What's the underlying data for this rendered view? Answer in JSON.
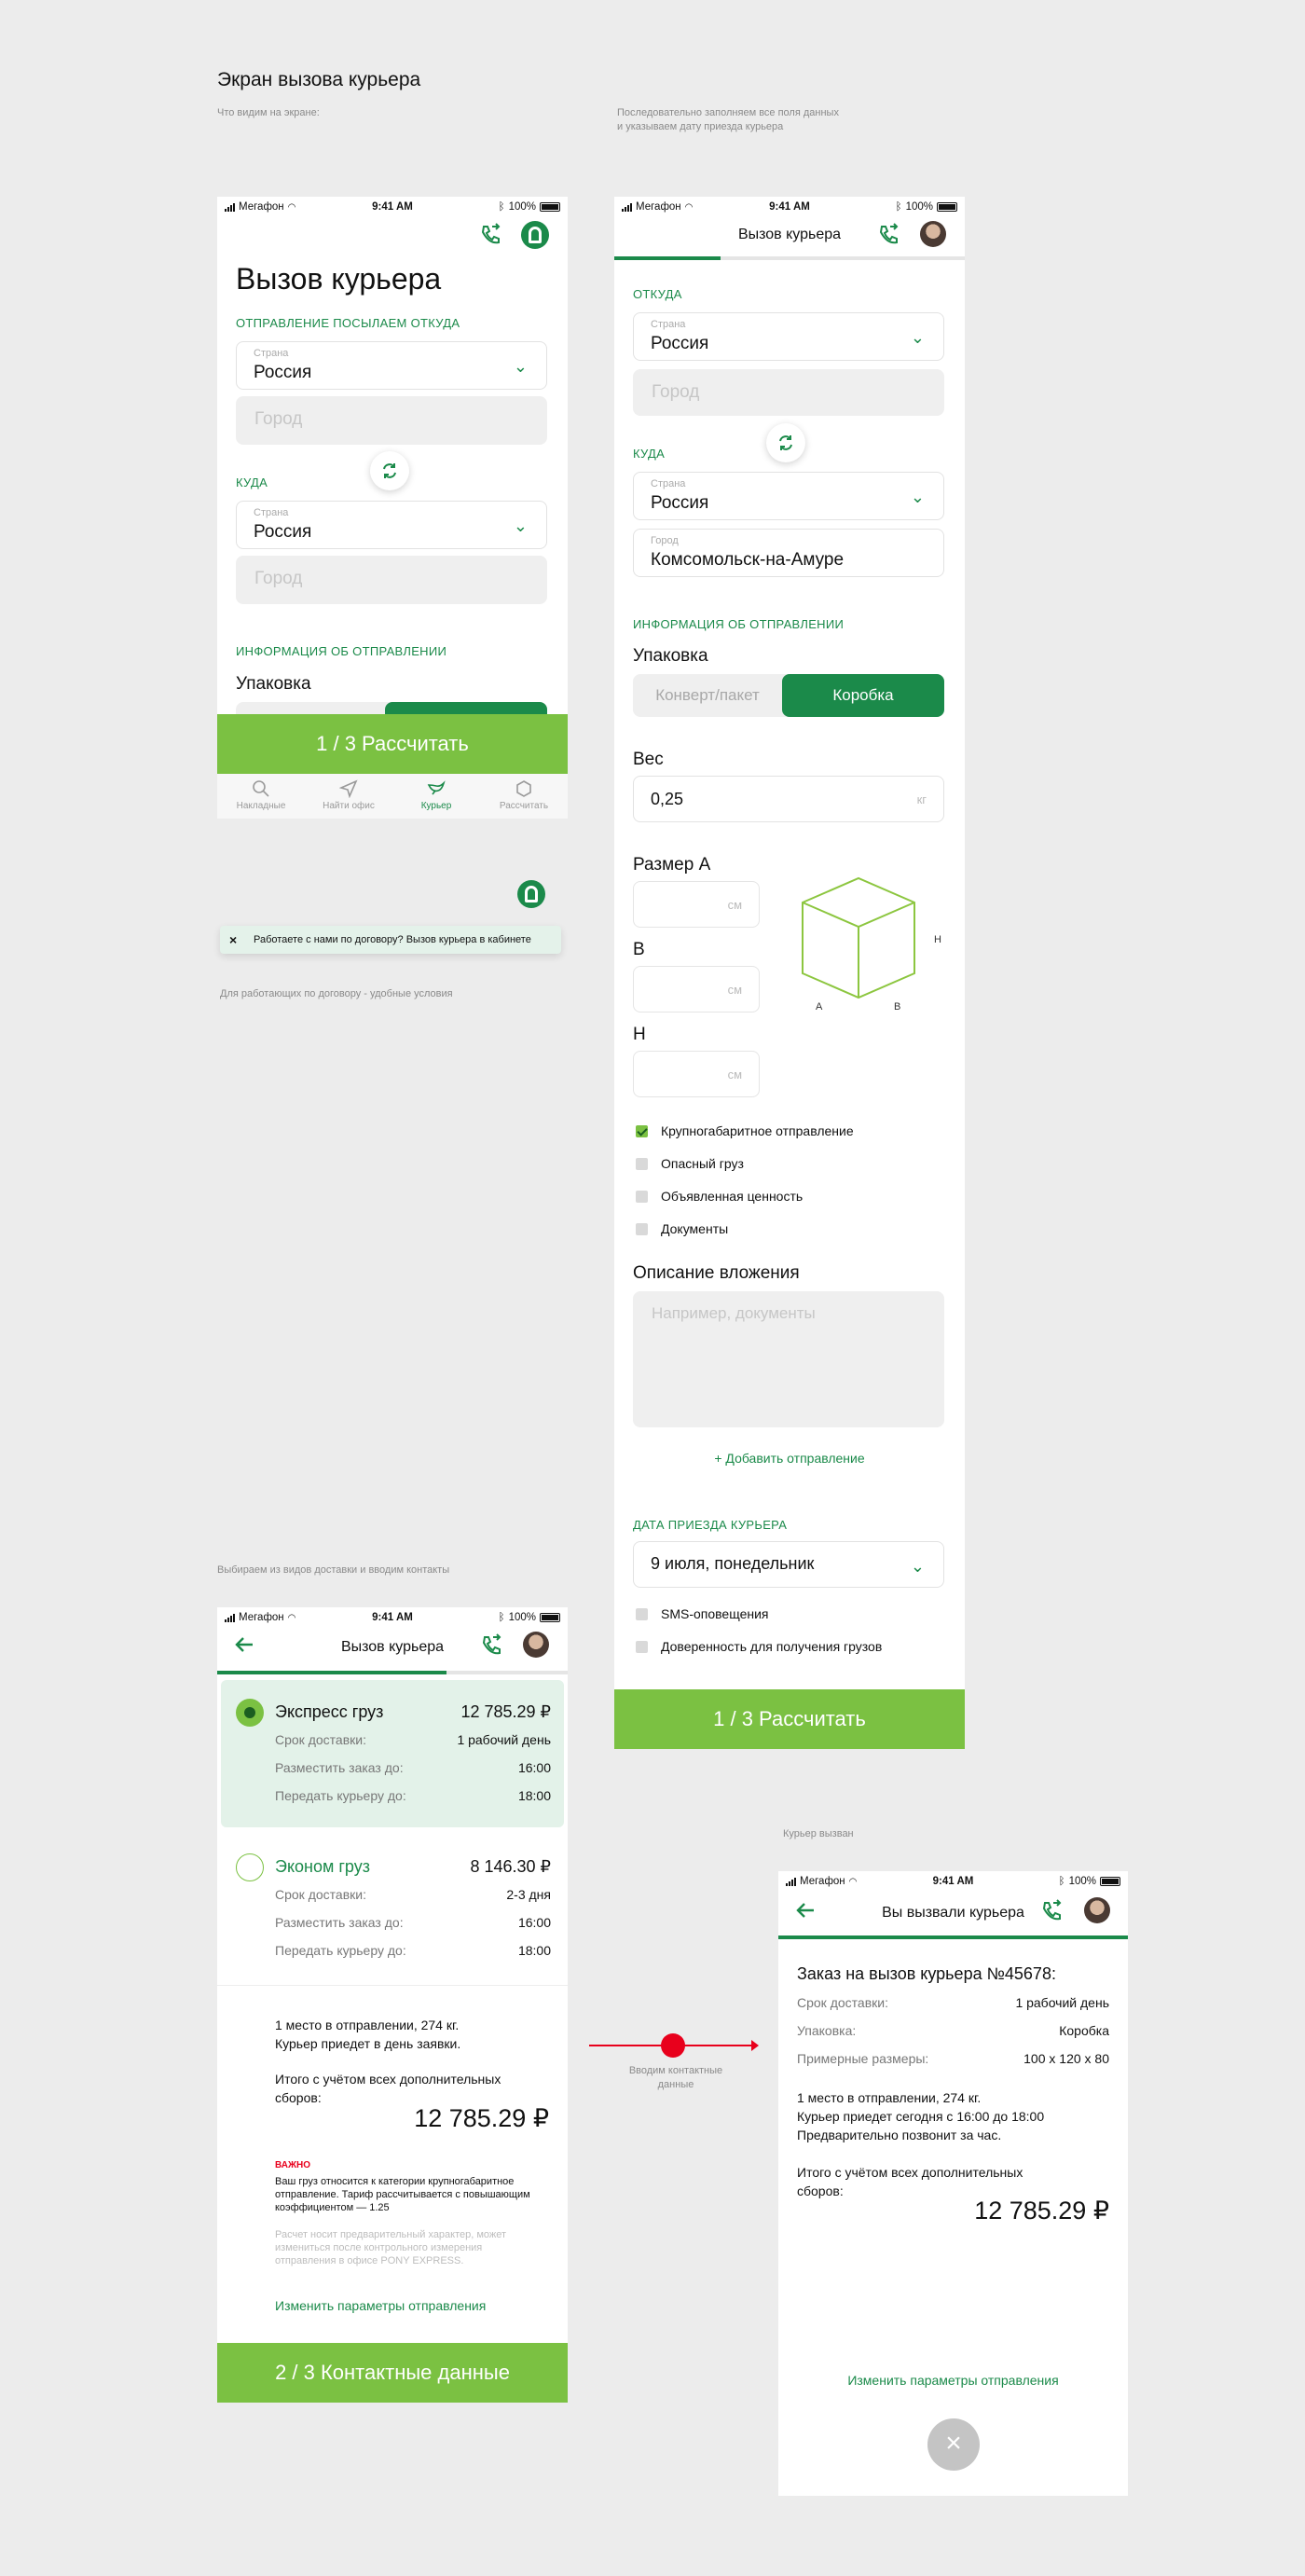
{
  "page": {
    "title": "Экран вызова курьера",
    "note1": "Что видим на экране:",
    "note2_line1": "Последовательно заполняем все поля данных",
    "note2_line2": "и указываем дату приезда курьера",
    "note3": "Для работающих по договору - удобные условия",
    "note4": "Выбираем из видов доставки и вводим контакты",
    "note5": "Курьер вызван",
    "flow_label_line1": "Вводим контактные",
    "flow_label_line2": "данные"
  },
  "status_bar": {
    "carrier": "Мегафон",
    "time": "9:41 AM",
    "battery": "100%"
  },
  "screen1": {
    "heading": "Вызов курьера",
    "from_section": "ОТПРАВЛЕНИЕ ПОСЫЛАЕМ ОТКУДА",
    "country_label": "Страна",
    "country_value": "Россия",
    "city_placeholder": "Город",
    "to_section": "КУДА",
    "info_section": "ИНФОРМАЦИЯ ОБ ОТПРАВЛЕНИИ",
    "packaging": "Упаковка",
    "cta": "1 / 3 Рассчитать",
    "tabs": [
      {
        "label": "Накладные",
        "icon": "search-icon"
      },
      {
        "label": "Найти офис",
        "icon": "location-arrow-icon"
      },
      {
        "label": "Курьер",
        "icon": "bird-icon"
      },
      {
        "label": "Рассчитать",
        "icon": "hexagon-icon"
      }
    ],
    "active_tab": 2
  },
  "toast": {
    "text": "Работаете с нами по договору? Вызов курьера в кабинете"
  },
  "screen2": {
    "header_title": "Вызов курьера",
    "from_section": "ОТКУДА",
    "country_label": "Страна",
    "country_value": "Россия",
    "city_placeholder": "Город",
    "to_section": "КУДА",
    "to_city_label": "Город",
    "to_city_value": "Комсомольск-на-Амуре",
    "info_section": "ИНФОРМАЦИЯ ОБ ОТПРАВЛЕНИИ",
    "packaging": "Упаковка",
    "pack_options": [
      "Конверт/пакет",
      "Коробка"
    ],
    "pack_selected": 1,
    "weight_label": "Вес",
    "weight_value": "0,25",
    "weight_unit": "кг",
    "size_a_label": "Размер A",
    "size_b_label": "B",
    "size_h_label": "H",
    "size_unit": "см",
    "cube_labels": {
      "a": "A",
      "b": "B",
      "h": "H"
    },
    "checkboxes": [
      {
        "label": "Крупногабаритное отправление",
        "checked": true
      },
      {
        "label": "Опасный груз",
        "checked": false
      },
      {
        "label": "Объявленная ценность",
        "checked": false
      },
      {
        "label": "Документы",
        "checked": false
      }
    ],
    "description_label": "Описание вложения",
    "description_placeholder": "Например, документы",
    "add_shipment": "+ Добавить отправление",
    "date_section": "ДАТА ПРИЕЗДА КУРЬЕРА",
    "date_value": "9 июля, понедельник",
    "extra_checkboxes": [
      {
        "label": "SMS-оповещения",
        "checked": false
      },
      {
        "label": "Доверенность для получения грузов",
        "checked": false
      }
    ],
    "cta": "1 / 3 Рассчитать"
  },
  "screen3": {
    "header_title": "Вызов курьера",
    "options": [
      {
        "name": "Экспресс груз",
        "price": "12 785.29 ₽",
        "selected": true,
        "rows": [
          [
            "Срок доставки:",
            "1 рабочий день"
          ],
          [
            "Разместить заказ до:",
            "16:00"
          ],
          [
            "Передать курьеру до:",
            "18:00"
          ]
        ]
      },
      {
        "name": "Эконом груз",
        "price": "8 146.30 ₽",
        "selected": false,
        "rows": [
          [
            "Срок доставки:",
            "2-3 дня"
          ],
          [
            "Разместить заказ до:",
            "16:00"
          ],
          [
            "Передать курьеру до:",
            "18:00"
          ]
        ]
      }
    ],
    "summary_line1": "1 место в отправлении, 274 кг.",
    "summary_line2": "Курьер приедет в день заявки.",
    "total_line1": "Итого с учётом всех дополнительных",
    "total_line2": "сборов:",
    "total": "12 785.29 ₽",
    "important_title": "ВАЖНО",
    "important_line1": "Ваш груз относится к категории крупногабаритное",
    "important_line2": "отправление. Тариф рассчитывается с повышающим",
    "important_line3": "коэффициентом — 1.25",
    "disclaimer_line1": "Расчет носит предварительный характер, может",
    "disclaimer_line2": "измениться после контрольного измерения",
    "disclaimer_line3": "отправления в офисе PONY EXPRESS.",
    "change_link": "Изменить параметры отправления",
    "cta": "2 / 3 Контактные данные"
  },
  "screen4": {
    "header_title": "Вы вызвали курьера",
    "order_title": "Заказ на вызов курьера №45678:",
    "rows": [
      [
        "Срок доставки:",
        "1 рабочий день"
      ],
      [
        "Упаковка:",
        "Коробка"
      ],
      [
        "Примерные размеры:",
        "100 x 120 x 80"
      ]
    ],
    "info_line1": "1 место в отправлении, 274 кг.",
    "info_line2": "Курьер приедет сегодня с 16:00 до 18:00",
    "info_line3": "Предварительно позвонит за час.",
    "total_line1": "Итого с учётом всех дополнительных",
    "total_line2": "сборов:",
    "total": "12 785.29 ₽",
    "change_link": "Изменить параметры отправления"
  },
  "colors": {
    "brand_green": "#1b8a4a",
    "cta_green": "#7bc142",
    "selected_bg": "#e3f2e9",
    "flow_red": "#e8001c"
  }
}
